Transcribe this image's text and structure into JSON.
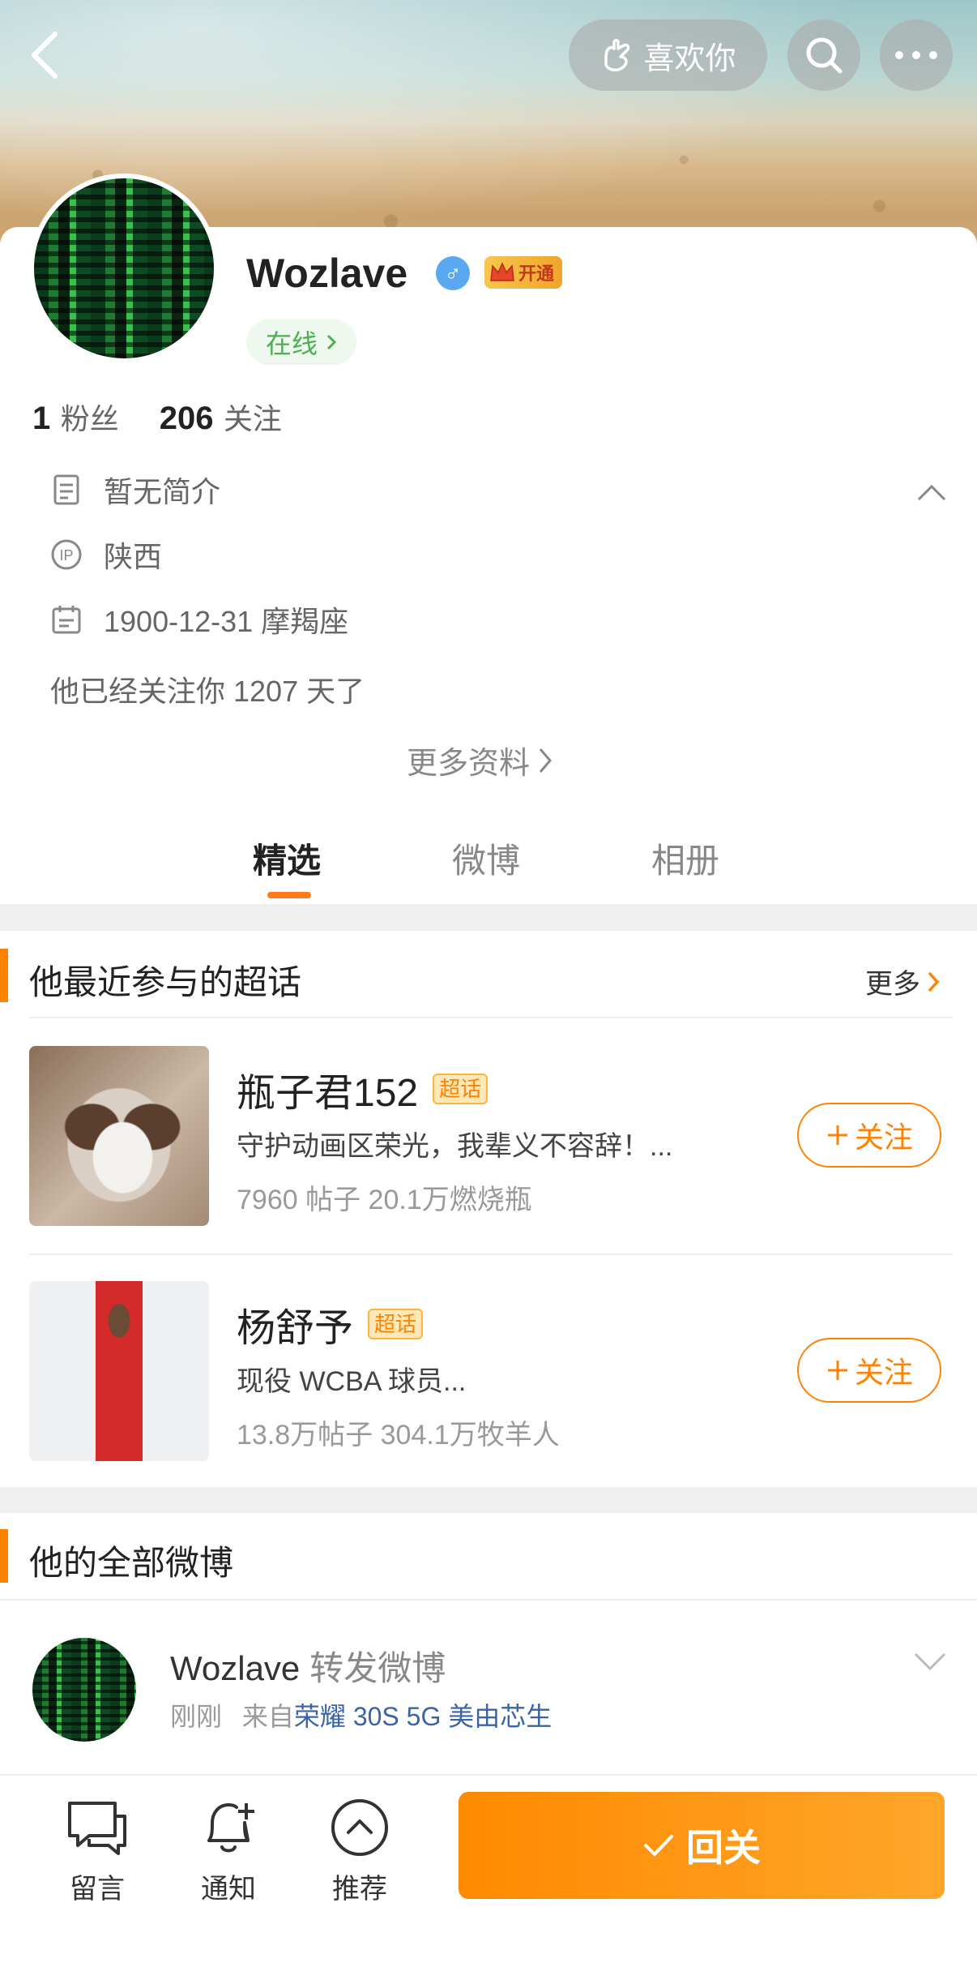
{
  "header": {
    "like_label": "喜欢你",
    "icons": [
      "back-arrow-icon",
      "hand-heart-icon",
      "search-icon",
      "more-dots-icon"
    ]
  },
  "profile": {
    "username": "Wozlave",
    "gender_symbol": "♂",
    "vip_label": "开通",
    "online_label": "在线",
    "followers_count": "1",
    "followers_label": "粉丝",
    "following_count": "206",
    "following_label": "关注",
    "bio": "暂无简介",
    "ip_location": "陕西",
    "birthday": "1900-12-31 摩羯座",
    "follow_days_text": "他已经关注你 1207 天了",
    "more_info_label": "更多资料"
  },
  "tabs": [
    {
      "label": "精选",
      "active": true
    },
    {
      "label": "微博",
      "active": false
    },
    {
      "label": "相册",
      "active": false
    }
  ],
  "topics_section": {
    "title": "他最近参与的超话",
    "more_label": "更多",
    "items": [
      {
        "name": "瓶子君152",
        "badge": "超话",
        "desc": "守护动画区荣光，我辈义不容辞！...",
        "meta": "7960 帖子  20.1万燃烧瓶",
        "follow_label": "关注"
      },
      {
        "name": "杨舒予",
        "badge": "超话",
        "desc": "现役 WCBA 球员...",
        "meta": "13.8万帖子  304.1万牧羊人",
        "follow_label": "关注"
      }
    ]
  },
  "posts_section": {
    "title": "他的全部微博",
    "post": {
      "user": "Wozlave",
      "action": "转发微博",
      "time": "刚刚",
      "from_label": "来自",
      "source": "荣耀 30S 5G 美由芯生"
    }
  },
  "bottom_bar": {
    "message_label": "留言",
    "notify_label": "通知",
    "recommend_label": "推荐",
    "follow_back_label": "回关"
  },
  "colors": {
    "accent": "#ff8200",
    "online_green": "#4caf50",
    "link_blue": "#3b64a8"
  }
}
